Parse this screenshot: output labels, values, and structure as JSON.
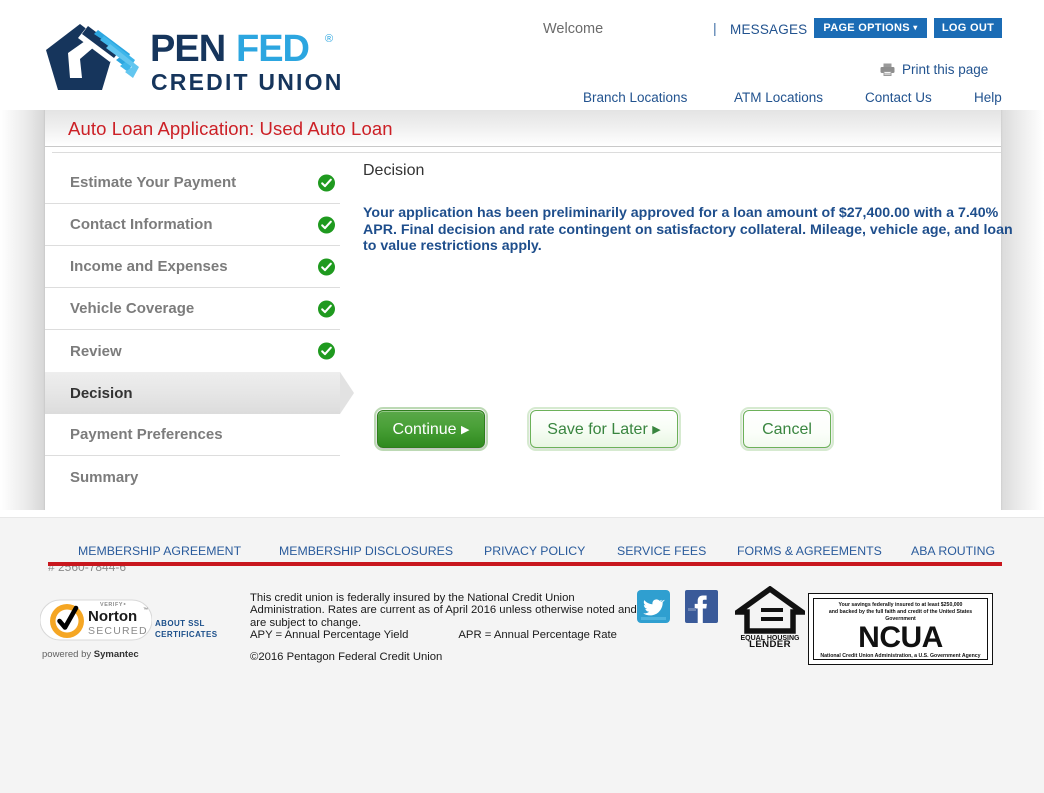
{
  "brand": {
    "name_part1": "PEN",
    "name_part2": "FED",
    "registered": "®",
    "tagline": "CREDIT UNION",
    "navy": "#16355c",
    "cyan": "#2ca6e0"
  },
  "header": {
    "welcome": "Welcome",
    "separator": "|",
    "messages_label": "MESSAGES",
    "page_options_label": "PAGE OPTIONS",
    "page_options_caret": "▾",
    "log_out_label": "LOG OUT",
    "print_label": "Print this page",
    "print_icon": "printer-icon",
    "nav": [
      {
        "label": "Branch Locations"
      },
      {
        "label": "ATM Locations"
      },
      {
        "label": "Contact Us"
      },
      {
        "label": "Help"
      }
    ],
    "accent_blue": "#1b6cb5",
    "link_blue": "#22538f"
  },
  "panel": {
    "title": "Auto Loan Application: Used Auto Loan",
    "title_color": "#cc2026"
  },
  "steps": [
    {
      "label": "Estimate Your Payment",
      "complete": true,
      "current": false
    },
    {
      "label": "Contact Information",
      "complete": true,
      "current": false
    },
    {
      "label": "Income and Expenses",
      "complete": true,
      "current": false
    },
    {
      "label": "Vehicle Coverage",
      "complete": true,
      "current": false
    },
    {
      "label": "Review",
      "complete": true,
      "current": false
    },
    {
      "label": "Decision",
      "complete": false,
      "current": true
    },
    {
      "label": "Payment Preferences",
      "complete": false,
      "current": false
    },
    {
      "label": "Summary",
      "complete": false,
      "current": false
    }
  ],
  "main": {
    "heading": "Decision",
    "decision_text": "Your application has been preliminarily approved for a loan amount of $27,400.00 with a 7.40% APR. Final decision and rate contingent on satisfactory collateral. Mileage, vehicle age, and loan to value restrictions apply.",
    "loan_amount": "$27,400.00",
    "apr": "7.40%",
    "text_color": "#1e4e8c"
  },
  "buttons": {
    "continue_label": "Continue",
    "continue_arrow": "▶",
    "save_later_label": "Save for Later",
    "save_later_arrow": "▶",
    "cancel_label": "Cancel",
    "green": "#2f8a1f"
  },
  "footer": {
    "links": [
      {
        "label": "MEMBERSHIP AGREEMENT"
      },
      {
        "label": "MEMBERSHIP DISCLOSURES"
      },
      {
        "label": "PRIVACY POLICY"
      },
      {
        "label": "SERVICE FEES"
      },
      {
        "label": "FORMS & AGREEMENTS"
      },
      {
        "label": "ABA ROUTING"
      }
    ],
    "rule_color": "#c8171e",
    "reference_number": "# 2560-7844-6",
    "norton": {
      "verify": "VERIFY‣",
      "name": "Norton",
      "secured": "SECURED",
      "tm": "™",
      "powered_prefix": "powered by ",
      "powered_brand": "Symantec",
      "about_line1": "ABOUT SSL",
      "about_line2": "CERTIFICATES"
    },
    "disclosure_line1": "This credit union is federally insured by the National Credit Union",
    "disclosure_line2": "Administration. Rates are current as of April 2016 unless otherwise noted and",
    "disclosure_line3": "are subject to change.",
    "apy_text": "APY = Annual Percentage Yield",
    "apr_text": "APR = Annual Percentage Rate",
    "copyright": "©2016 Pentagon Federal Credit Union",
    "social": [
      {
        "name": "twitter",
        "color": "#2f9fd0"
      },
      {
        "name": "facebook",
        "color": "#3a5a99"
      }
    ],
    "equal_housing_line1": "EQUAL HOUSING",
    "equal_housing_line2": "LENDER",
    "ncua": {
      "top_line1": "Your savings federally insured to at least $250,000",
      "top_line2": "and backed by the full faith and credit of the United States Government",
      "word": "NCUA",
      "bottom": "National Credit Union Administration, a U.S. Government Agency"
    }
  }
}
